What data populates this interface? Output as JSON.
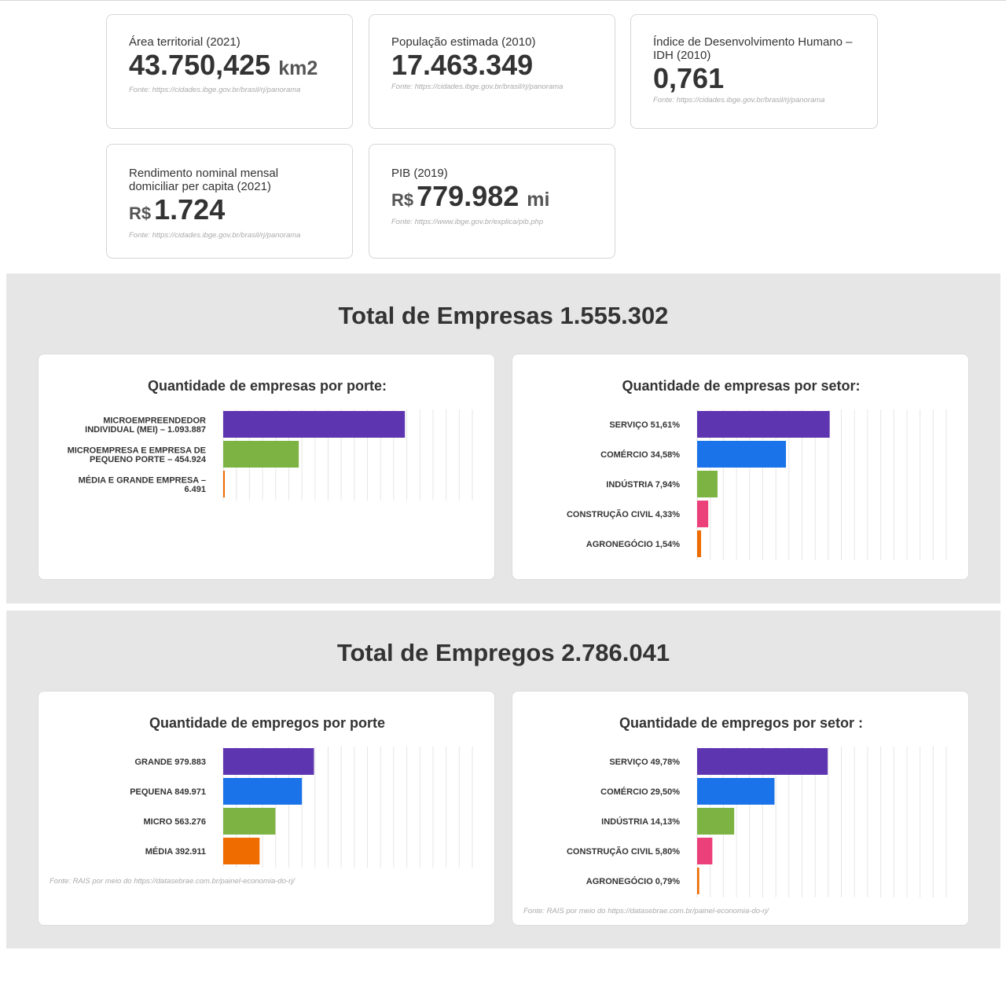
{
  "stats": [
    {
      "label": "Área territorial (2021)",
      "prefix": "",
      "value": "43.750,425",
      "unit": "km2",
      "source": "Fonte: https://cidades.ibge.gov.br/brasil/rj/panorama"
    },
    {
      "label": "População estimada (2010)",
      "prefix": "",
      "value": "17.463.349",
      "unit": "",
      "source": "Fonte: https://cidades.ibge.gov.br/brasil/rj/panorama"
    },
    {
      "label": "Índice de Desenvolvimento Humano – IDH (2010)",
      "prefix": "",
      "value": "0,761",
      "unit": "",
      "source": "Fonte: https://cidades.ibge.gov.br/brasil/rj/panorama"
    },
    {
      "label": "Rendimento nominal mensal domiciliar per capita (2021)",
      "prefix": "R$",
      "value": "1.724",
      "unit": "",
      "source": "Fonte: https://cidades.ibge.gov.br/brasil/rj/panorama"
    },
    {
      "label": "PIB (2019)",
      "prefix": "R$",
      "value": "779.982",
      "unit": "mi",
      "source": "Fonte: https://www.ibge.gov.br/explica/pib.php"
    }
  ],
  "empresas_section": {
    "title": "Total de Empresas 1.555.302"
  },
  "empregos_section": {
    "title": "Total de Empregos 2.786.041"
  },
  "chart_data": [
    {
      "type": "bar",
      "orientation": "horizontal",
      "title": "Quantidade de empresas por porte:",
      "categories": [
        "MICROEMPREENDEDOR INDIVIDUAL (MEI) – 1.093.887",
        "MICROEMPRESA E EMPRESA DE PEQUENO PORTE – 454.924",
        "MÉDIA E GRANDE EMPRESA – 6.491"
      ],
      "values": [
        1093887,
        454924,
        6491
      ],
      "colors": [
        "#5e35b1",
        "#7cb342",
        "#ef6c00"
      ],
      "xlim": [
        0,
        1500000
      ],
      "grid": true,
      "source": ""
    },
    {
      "type": "bar",
      "orientation": "horizontal",
      "title": "Quantidade de empresas por setor:",
      "categories": [
        "SERVIÇO 51,61%",
        "COMÉRCIO 34,58%",
        "INDÚSTRIA 7,94%",
        "CONSTRUÇÃO CIVIL 4,33%",
        "AGRONEGÓCIO 1,54%"
      ],
      "values": [
        51.61,
        34.58,
        7.94,
        4.33,
        1.54
      ],
      "colors": [
        "#5e35b1",
        "#1a73e8",
        "#7cb342",
        "#ec407a",
        "#ef6c00"
      ],
      "xlim": [
        0,
        97
      ],
      "grid": true,
      "source": ""
    },
    {
      "type": "bar",
      "orientation": "horizontal",
      "title": "Quantidade de empregos por porte",
      "categories": [
        "GRANDE 979.883",
        "PEQUENA 849.971",
        "MICRO 563.276",
        "MÉDIA 392.911"
      ],
      "values": [
        979883,
        849971,
        563276,
        392911
      ],
      "colors": [
        "#5e35b1",
        "#1a73e8",
        "#7cb342",
        "#ef6c00"
      ],
      "xlim": [
        0,
        2690000
      ],
      "grid": true,
      "source": "Fonte: RAIS por meio do https://datasebrae.com.br/painel-economia-do-rj/"
    },
    {
      "type": "bar",
      "orientation": "horizontal",
      "title": "Quantidade de empregos por setor :",
      "categories": [
        "SERVIÇO 49,78%",
        "COMÉRCIO 29,50%",
        "INDÚSTRIA 14,13%",
        "CONSTRUÇÃO CIVIL 5,80%",
        "AGRONEGÓCIO 0,79%"
      ],
      "values": [
        49.78,
        29.5,
        14.13,
        5.8,
        0.79
      ],
      "colors": [
        "#5e35b1",
        "#1a73e8",
        "#7cb342",
        "#ec407a",
        "#ef6c00"
      ],
      "xlim": [
        0,
        95
      ],
      "grid": true,
      "source": "Fonte: RAIS por meio do https://datasebrae.com.br/painel-economia-do-rj/"
    }
  ]
}
